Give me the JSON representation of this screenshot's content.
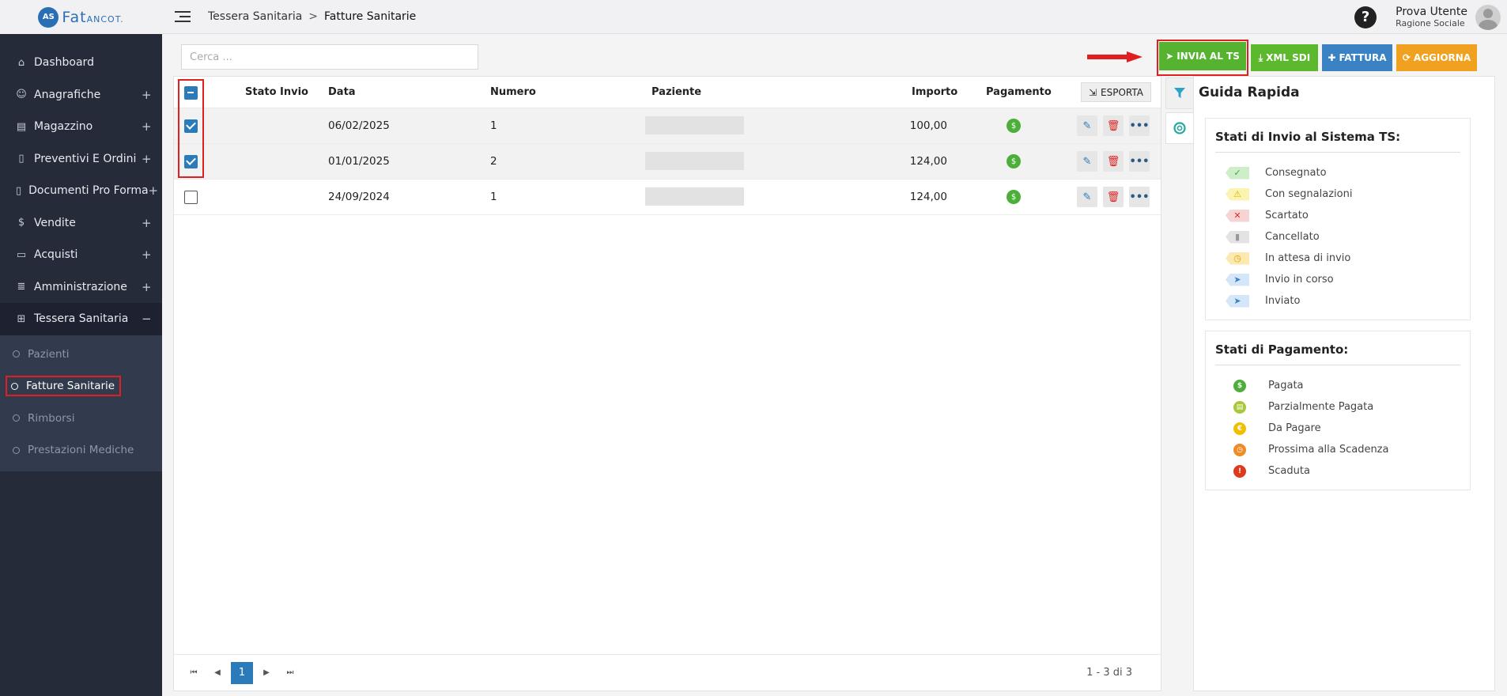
{
  "brand": {
    "mark": "AS",
    "name": "Fat",
    "suffix": "ANCOT."
  },
  "sidebar": {
    "items": [
      {
        "label": "Dashboard",
        "icon": "home-icon",
        "glyph": "⌂",
        "expand": ""
      },
      {
        "label": "Anagrafiche",
        "icon": "user-icon",
        "glyph": "☺",
        "expand": "+"
      },
      {
        "label": "Magazzino",
        "icon": "archive-icon",
        "glyph": "▤",
        "expand": "+"
      },
      {
        "label": "Preventivi E Ordini",
        "icon": "clipboard-icon",
        "glyph": "▯",
        "expand": "+"
      },
      {
        "label": "Documenti Pro Forma",
        "icon": "document-icon",
        "glyph": "▯",
        "expand": "+"
      },
      {
        "label": "Vendite",
        "icon": "dollar-icon",
        "glyph": "$",
        "expand": "+"
      },
      {
        "label": "Acquisti",
        "icon": "credit-card-icon",
        "glyph": "▭",
        "expand": "+"
      },
      {
        "label": "Amministrazione",
        "icon": "database-icon",
        "glyph": "≣",
        "expand": "+"
      },
      {
        "label": "Tessera Sanitaria",
        "icon": "medical-icon",
        "glyph": "⊞",
        "expand": "−"
      }
    ],
    "subitems": [
      {
        "label": "Pazienti"
      },
      {
        "label": "Fatture Sanitarie"
      },
      {
        "label": "Rimborsi"
      },
      {
        "label": "Prestazioni Mediche"
      }
    ]
  },
  "topbar": {
    "crumb_parent": "Tessera Sanitaria",
    "crumb_sep": ">",
    "crumb_current": "Fatture Sanitarie",
    "help": "?",
    "user_name": "Prova Utente",
    "user_role": "Ragione Sociale"
  },
  "toolbar": {
    "search_placeholder": "Cerca ...",
    "buttons": {
      "invia": "INVIA AL TS",
      "xml": "XML SDI",
      "fattura": "FATTURA",
      "aggiorna": "AGGIORNA"
    }
  },
  "table": {
    "headers": {
      "stato": "Stato Invio",
      "data": "Data",
      "numero": "Numero",
      "paziente": "Paziente",
      "importo": "Importo",
      "pagamento": "Pagamento",
      "esporta": "ESPORTA"
    },
    "rows": [
      {
        "data": "06/02/2025",
        "numero": "1",
        "importo": "100,00",
        "selected": true
      },
      {
        "data": "01/01/2025",
        "numero": "2",
        "importo": "124,00",
        "selected": true
      },
      {
        "data": "24/09/2024",
        "numero": "1",
        "importo": "124,00",
        "selected": false
      }
    ],
    "pager": {
      "page": "1",
      "info": "1 - 3 di 3"
    }
  },
  "guide": {
    "title": "Guida Rapida",
    "invio_title": "Stati di Invio al Sistema TS:",
    "invio": [
      {
        "label": "Consegnato",
        "glyph": "✓",
        "bg": "#cdeec8",
        "fg": "#3aa93a"
      },
      {
        "label": "Con segnalazioni",
        "glyph": "⚠",
        "bg": "#fbf3b0",
        "fg": "#d8b000"
      },
      {
        "label": "Scartato",
        "glyph": "✕",
        "bg": "#f8d3d3",
        "fg": "#d83030"
      },
      {
        "label": "Cancellato",
        "glyph": "▮",
        "bg": "#e3e3e3",
        "fg": "#999999"
      },
      {
        "label": "In attesa di invio",
        "glyph": "◷",
        "bg": "#fce9b2",
        "fg": "#e0a000"
      },
      {
        "label": "Invio in corso",
        "glyph": "➤",
        "bg": "#d4e6f8",
        "fg": "#3a82c4"
      },
      {
        "label": "Inviato",
        "glyph": "➤",
        "bg": "#d4e6f8",
        "fg": "#3a82c4"
      }
    ],
    "pagamento_title": "Stati di Pagamento:",
    "pagamento": [
      {
        "label": "Pagata",
        "glyph": "$",
        "color": "#4caf3a"
      },
      {
        "label": "Parzialmente Pagata",
        "glyph": "▤",
        "color": "#a8c83a"
      },
      {
        "label": "Da Pagare",
        "glyph": "€",
        "color": "#f0c000"
      },
      {
        "label": "Prossima alla Scadenza",
        "glyph": "◷",
        "color": "#f08a24"
      },
      {
        "label": "Scaduta",
        "glyph": "!",
        "color": "#e03a1e"
      }
    ]
  }
}
